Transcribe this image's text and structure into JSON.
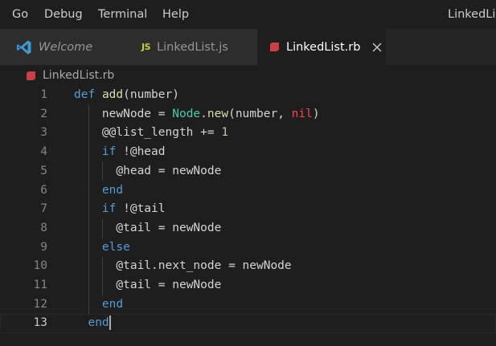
{
  "menu": {
    "items": [
      "Go",
      "Debug",
      "Terminal",
      "Help"
    ],
    "window_title": "LinkedLis"
  },
  "tabs": [
    {
      "label": "Welcome",
      "icon": "vscode-logo-icon",
      "active": false
    },
    {
      "label": "LinkedList.js",
      "icon": "javascript-file-icon",
      "icon_text": "JS",
      "active": false
    },
    {
      "label": "LinkedList.rb",
      "icon": "ruby-file-icon",
      "active": true
    }
  ],
  "breadcrumb": {
    "file": "LinkedList.rb",
    "icon": "ruby-file-icon"
  },
  "editor": {
    "current_line": 13,
    "line_numbers": [
      "1",
      "2",
      "3",
      "4",
      "5",
      "6",
      "7",
      "8",
      "9",
      "10",
      "11",
      "12",
      "13"
    ],
    "lines": [
      {
        "indent": "",
        "tokens": [
          {
            "t": "def",
            "c": "kw"
          },
          {
            "t": " ",
            "c": ""
          },
          {
            "t": "add",
            "c": "fn"
          },
          {
            "t": "(number)",
            "c": ""
          }
        ]
      },
      {
        "indent": "    ",
        "tokens": [
          {
            "t": "newNode = ",
            "c": ""
          },
          {
            "t": "Node",
            "c": "cls"
          },
          {
            "t": ".",
            "c": ""
          },
          {
            "t": "new",
            "c": "fn"
          },
          {
            "t": "(number, ",
            "c": ""
          },
          {
            "t": "nil",
            "c": "nil"
          },
          {
            "t": ")",
            "c": ""
          }
        ]
      },
      {
        "indent": "    ",
        "tokens": [
          {
            "t": "@@list_length += ",
            "c": ""
          },
          {
            "t": "1",
            "c": "num"
          }
        ]
      },
      {
        "indent": "    ",
        "tokens": [
          {
            "t": "if",
            "c": "kw"
          },
          {
            "t": " !@head",
            "c": ""
          }
        ]
      },
      {
        "indent": "      ",
        "tokens": [
          {
            "t": "@head = newNode",
            "c": ""
          }
        ]
      },
      {
        "indent": "    ",
        "tokens": [
          {
            "t": "end",
            "c": "kw"
          }
        ]
      },
      {
        "indent": "    ",
        "tokens": [
          {
            "t": "if",
            "c": "kw"
          },
          {
            "t": " !@tail",
            "c": ""
          }
        ]
      },
      {
        "indent": "      ",
        "tokens": [
          {
            "t": "@tail = newNode",
            "c": ""
          }
        ]
      },
      {
        "indent": "    ",
        "tokens": [
          {
            "t": "else",
            "c": "kw"
          }
        ]
      },
      {
        "indent": "      ",
        "tokens": [
          {
            "t": "@tail.next_node = newNode",
            "c": ""
          }
        ]
      },
      {
        "indent": "      ",
        "tokens": [
          {
            "t": "@tail = newNode",
            "c": ""
          }
        ]
      },
      {
        "indent": "    ",
        "tokens": [
          {
            "t": "end",
            "c": "kw"
          }
        ]
      },
      {
        "indent": "  ",
        "tokens": [
          {
            "t": "end",
            "c": "kw"
          }
        ]
      }
    ]
  },
  "colors": {
    "background": "#1e1e1e",
    "keyword": "#569cd6",
    "function": "#dcdcaa",
    "class": "#4ec9b0",
    "number": "#b5cea8",
    "nil": "#f44747",
    "ruby_icon": "#cc3e44",
    "js_icon": "#cbcb41",
    "vscode_icon": "#3c99d4"
  }
}
